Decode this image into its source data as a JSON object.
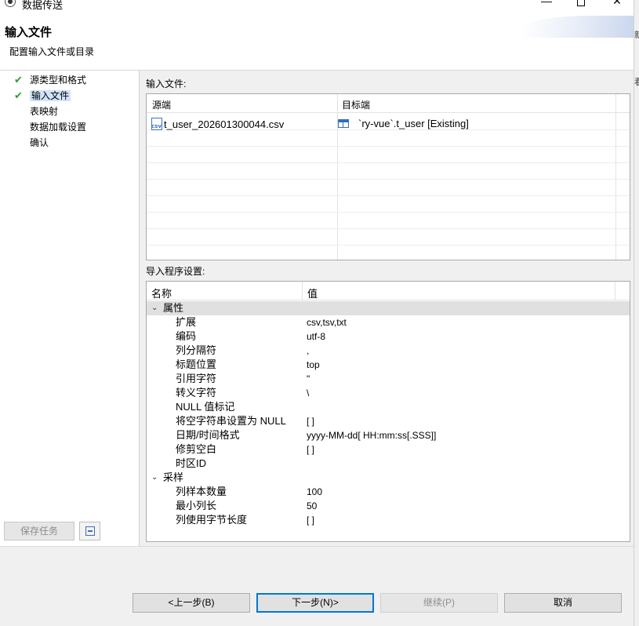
{
  "window": {
    "title": "数据传送",
    "minimize_glyph": "—",
    "close_glyph": "✕"
  },
  "header": {
    "heading": "输入文件",
    "description": "配置输入文件或目录"
  },
  "right_edge": {
    "fragment_1": "新",
    "fragment_2": "看"
  },
  "sidebar": {
    "items": [
      {
        "label": "源类型和格式",
        "done": true,
        "selected": false
      },
      {
        "label": "输入文件",
        "done": true,
        "selected": true
      },
      {
        "label": "表映射",
        "done": false,
        "selected": false
      },
      {
        "label": "数据加载设置",
        "done": false,
        "selected": false
      },
      {
        "label": "确认",
        "done": false,
        "selected": false
      }
    ],
    "check_glyph": "✔",
    "save_task_label": "保存任务"
  },
  "input_files": {
    "label": "输入文件:",
    "col_source": "源端",
    "col_target": "目标端",
    "rows": [
      {
        "source": "t_user_202601300044.csv",
        "target": "`ry-vue`.t_user [Existing]",
        "icon_text": "csv"
      }
    ]
  },
  "importer": {
    "label": "导入程序设置:",
    "col_name": "名称",
    "col_value": "值",
    "chevron_glyph": "⌄",
    "group_properties": "属性",
    "group_sampling": "采样",
    "properties": [
      {
        "key": "扩展",
        "value": "csv,tsv,txt"
      },
      {
        "key": "编码",
        "value": "utf-8"
      },
      {
        "key": "列分隔符",
        "value": ","
      },
      {
        "key": "标题位置",
        "value": "top"
      },
      {
        "key": "引用字符",
        "value": "\""
      },
      {
        "key": "转义字符",
        "value": "\\"
      },
      {
        "key": "NULL 值标记",
        "value": ""
      },
      {
        "key": "将空字符串设置为 NULL",
        "value": "[ ]"
      },
      {
        "key": "日期/时间格式",
        "value": "yyyy-MM-dd[ HH:mm:ss[.SSS]]"
      },
      {
        "key": "修剪空白",
        "value": "[ ]"
      },
      {
        "key": "时区ID",
        "value": ""
      }
    ],
    "sampling": [
      {
        "key": "列样本数量",
        "value": "100"
      },
      {
        "key": "最小列长",
        "value": "50"
      },
      {
        "key": "列使用字节长度",
        "value": "[ ]"
      }
    ]
  },
  "footer": {
    "back_label": "<上一步(B)",
    "next_label": "下一步(N)>",
    "continue_label": "继续(P)",
    "cancel_label": "取消"
  }
}
